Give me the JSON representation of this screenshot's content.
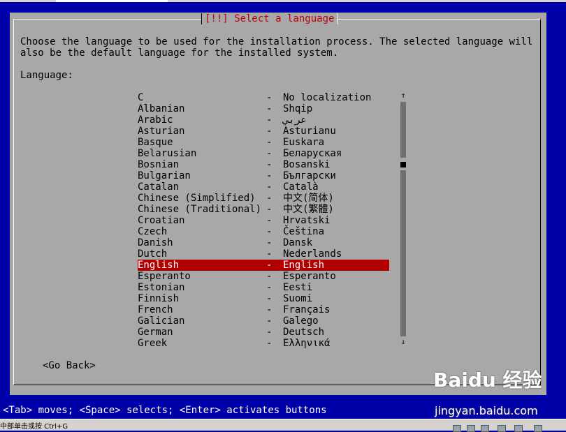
{
  "dialog": {
    "title": "[!!] Select a language",
    "description": "Choose the language to be used for the installation process. The selected language will\nalso be the default language for the installed system.",
    "list_label": "Language:",
    "languages": [
      {
        "name": "C",
        "native": "No localization"
      },
      {
        "name": "Albanian",
        "native": "Shqip"
      },
      {
        "name": "Arabic",
        "native": "عربي"
      },
      {
        "name": "Asturian",
        "native": "Asturianu"
      },
      {
        "name": "Basque",
        "native": "Euskara"
      },
      {
        "name": "Belarusian",
        "native": "Беларуская"
      },
      {
        "name": "Bosnian",
        "native": "Bosanski"
      },
      {
        "name": "Bulgarian",
        "native": "Български"
      },
      {
        "name": "Catalan",
        "native": "Català"
      },
      {
        "name": "Chinese (Simplified)",
        "native": "中文(简体)"
      },
      {
        "name": "Chinese (Traditional)",
        "native": "中文(繁體)"
      },
      {
        "name": "Croatian",
        "native": "Hrvatski"
      },
      {
        "name": "Czech",
        "native": "Čeština"
      },
      {
        "name": "Danish",
        "native": "Dansk"
      },
      {
        "name": "Dutch",
        "native": "Nederlands"
      },
      {
        "name": "English",
        "native": "English",
        "selected": true
      },
      {
        "name": "Esperanto",
        "native": "Esperanto"
      },
      {
        "name": "Estonian",
        "native": "Eesti"
      },
      {
        "name": "Finnish",
        "native": "Suomi"
      },
      {
        "name": "French",
        "native": "Français"
      },
      {
        "name": "Galician",
        "native": "Galego"
      },
      {
        "name": "German",
        "native": "Deutsch"
      },
      {
        "name": "Greek",
        "native": "Ελληνικά"
      }
    ],
    "separator": "-",
    "go_back": "<Go Back>"
  },
  "status_bar": "<Tab> moves; <Space> selects; <Enter> activates buttons",
  "taskbar": {
    "text": "中部单击或按 Ctrl+G"
  },
  "watermark": {
    "logo": "Baidu 经验",
    "url": "jingyan.baidu.com"
  },
  "colors": {
    "background": "#0000a8",
    "dialog": "#a8a8a8",
    "selection": "#b00000",
    "title": "#c00000"
  }
}
